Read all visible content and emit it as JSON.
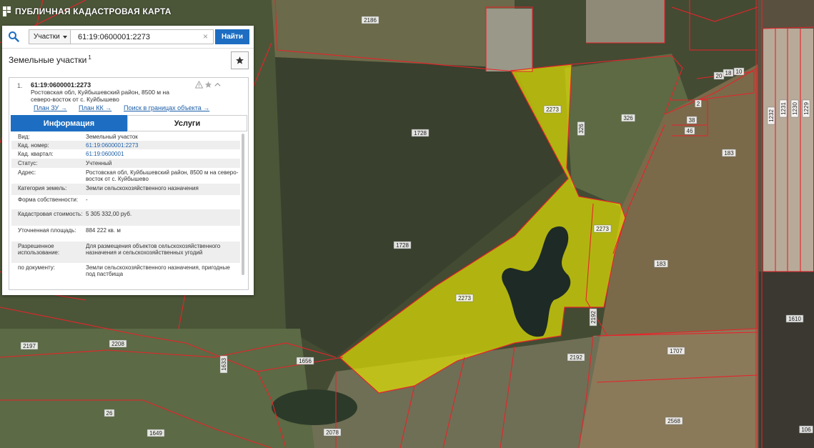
{
  "header": {
    "title": "ПУБЛИЧНАЯ КАДАСТРОВАЯ КАРТА"
  },
  "search": {
    "type_label": "Участки",
    "query": "61:19:0600001:2273",
    "find_label": "Найти"
  },
  "results": {
    "section_title": "Земельные участки",
    "count": "1",
    "item": {
      "num": "1.",
      "id": "61:19:0600001:2273",
      "address": "Ростовская обл, Куйбышевский район, 8500 м на северо-восток от с. Куйбышево",
      "links": [
        "План ЗУ →",
        "План КК →",
        "Поиск в границах объекта →"
      ]
    }
  },
  "tabs": [
    "Информация",
    "Услуги"
  ],
  "properties": [
    {
      "key": "Вид:",
      "value": "Земельный участок"
    },
    {
      "key": "Кад. номер:",
      "value": "61:19:0600001:2273",
      "link": true
    },
    {
      "key": "Кад. квартал:",
      "value": "61:19:0600001",
      "link": true
    },
    {
      "key": "Статус:",
      "value": "Учтенный"
    },
    {
      "key": "Адрес:",
      "value": "Ростовская обл, Куйбышевский район, 8500 м на северо-восток от с. Куйбышево"
    },
    {
      "key": "Категория земель:",
      "value": "Земли сельскохозяйственного назначения"
    },
    {
      "key": "Форма собственности:",
      "value": "-"
    },
    {
      "key": "Кадастровая стоимость:",
      "value": "5 305 332,00 руб."
    },
    {
      "key": "Уточненная площадь:",
      "value": "884 222 кв. м"
    },
    {
      "key": "Разрешенное использование:",
      "value": "Для размещения объектов сельскохозяйственного назначения и сельскохозяйственных угодий"
    },
    {
      "key": "по документу:",
      "value": "Земли сельскохозяйственного назначения, пригодные под пастбища"
    }
  ],
  "map": {
    "parcel_labels": [
      "2186",
      "2273",
      "2273",
      "2273",
      "326",
      "326",
      "1728",
      "1728",
      "183",
      "183",
      "2",
      "38",
      "46",
      "20",
      "18",
      "10",
      "1232",
      "1231",
      "1230",
      "1229",
      "1610",
      "1707",
      "2192",
      "2192",
      "2197",
      "2208",
      "1633",
      "1656",
      "26",
      "1649",
      "2078",
      "2568",
      "106",
      "2193"
    ],
    "colors": {
      "selected_fill": "#e6e600",
      "boundary": "#e8232a",
      "accent": "#1d6ec2"
    }
  }
}
